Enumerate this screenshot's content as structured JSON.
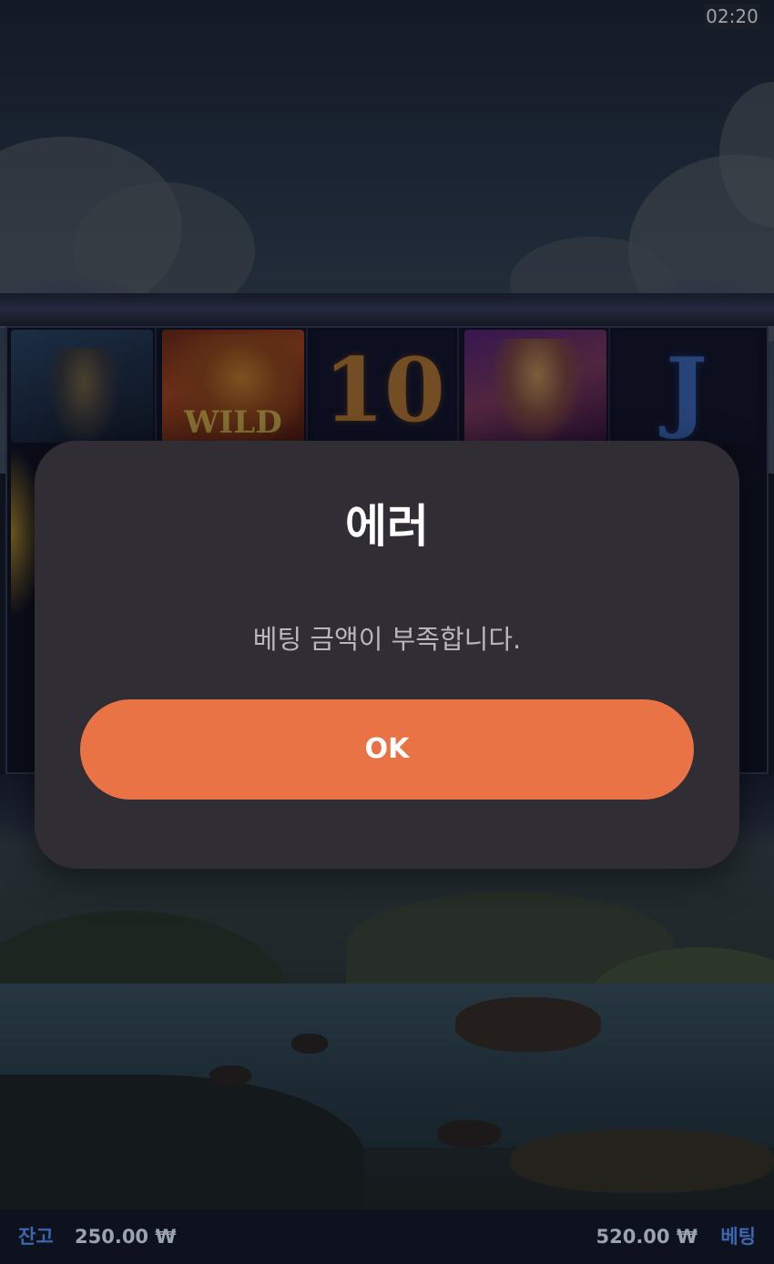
{
  "status_bar": {
    "clock": "02:20"
  },
  "reels": {
    "symbols_top_row": [
      {
        "name": "knight",
        "text": ""
      },
      {
        "name": "wild-dragon",
        "text": "WILD"
      },
      {
        "name": "ten",
        "text": "10"
      },
      {
        "name": "queen",
        "text": ""
      },
      {
        "name": "jack",
        "text": "J"
      }
    ]
  },
  "dialog": {
    "title": "에러",
    "message": "베팅 금액이 부족합니다.",
    "ok_label": "OK",
    "colors": {
      "background": "#302d34",
      "button": "#e97344"
    }
  },
  "bottom_bar": {
    "balance_label": "잔고",
    "balance_value": "250.00 ₩",
    "bet_value": "520.00 ₩",
    "bet_label": "베팅"
  }
}
